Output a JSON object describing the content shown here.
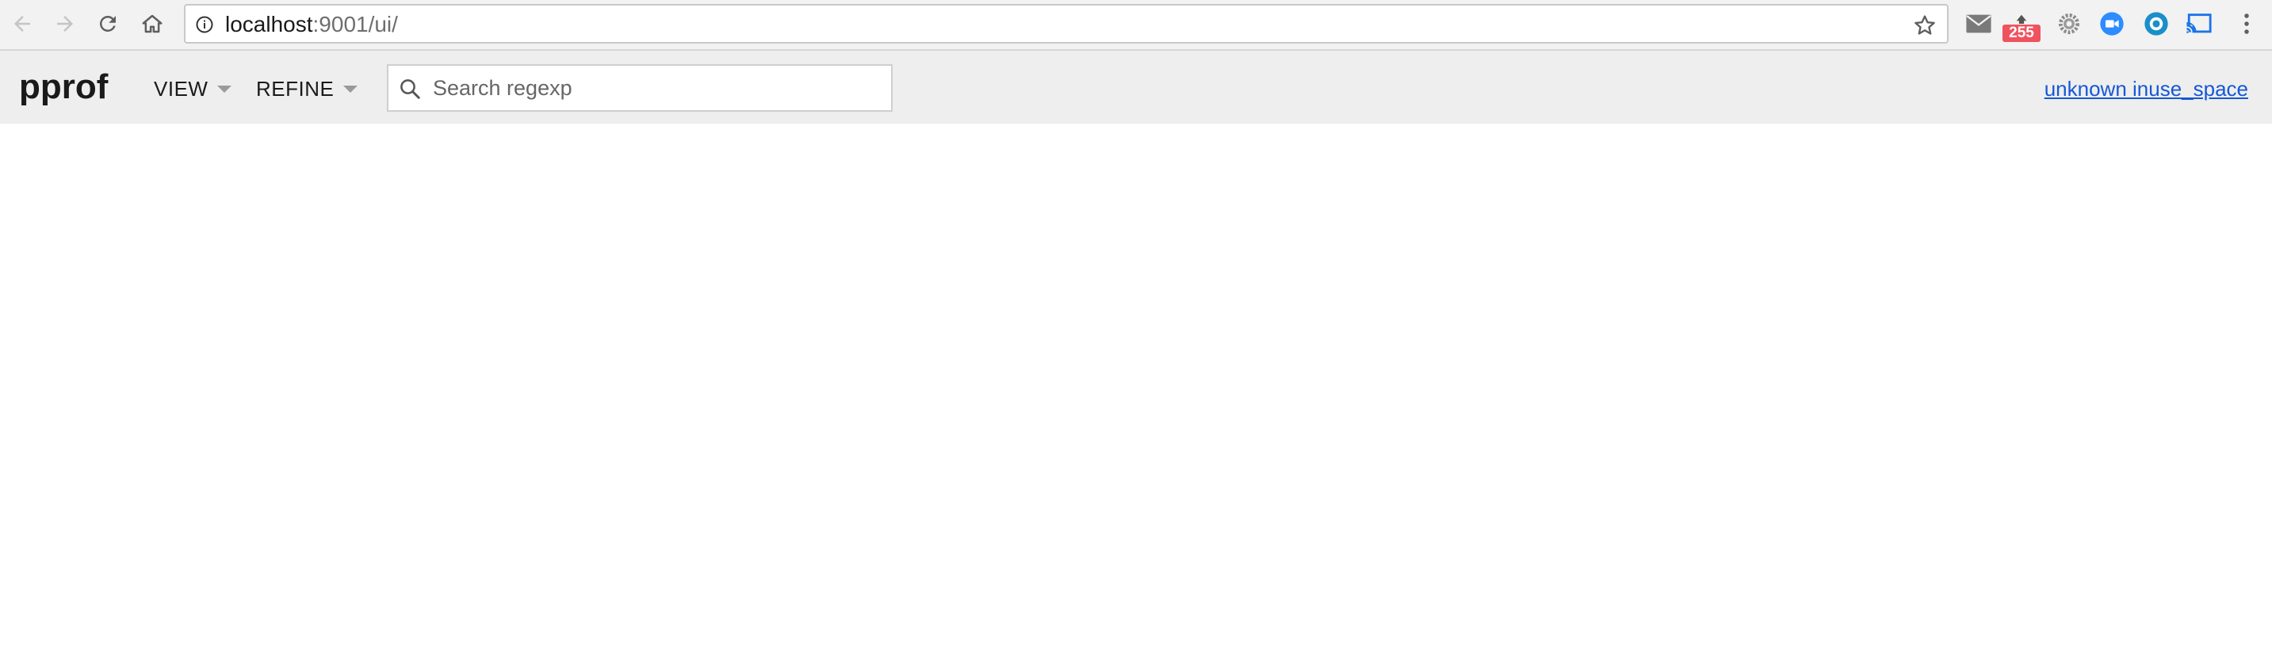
{
  "browser": {
    "url_host": "localhost",
    "url_path": ":9001/ui/",
    "icons": {
      "back": "back-arrow-icon",
      "forward": "forward-arrow-icon",
      "reload": "reload-icon",
      "home": "home-icon",
      "site_info": "info-icon",
      "bookmark": "star-icon"
    },
    "extensions": [
      {
        "name": "mail-icon"
      },
      {
        "name": "inbox-tray-icon",
        "badge": "255"
      },
      {
        "name": "gear-icon"
      },
      {
        "name": "video-camera-icon"
      },
      {
        "name": "circle-icon"
      },
      {
        "name": "cast-icon"
      },
      {
        "name": "more-vertical-icon"
      }
    ],
    "badge_color": "#f0525e"
  },
  "app": {
    "brand": "pprof",
    "menus": [
      {
        "label": "VIEW"
      },
      {
        "label": "REFINE"
      }
    ],
    "search": {
      "placeholder": "Search regexp",
      "value": ""
    },
    "profile_link": "unknown inuse_space",
    "colors": {
      "toolbar_bg": "#eeeeee",
      "link": "#1558d6"
    }
  }
}
